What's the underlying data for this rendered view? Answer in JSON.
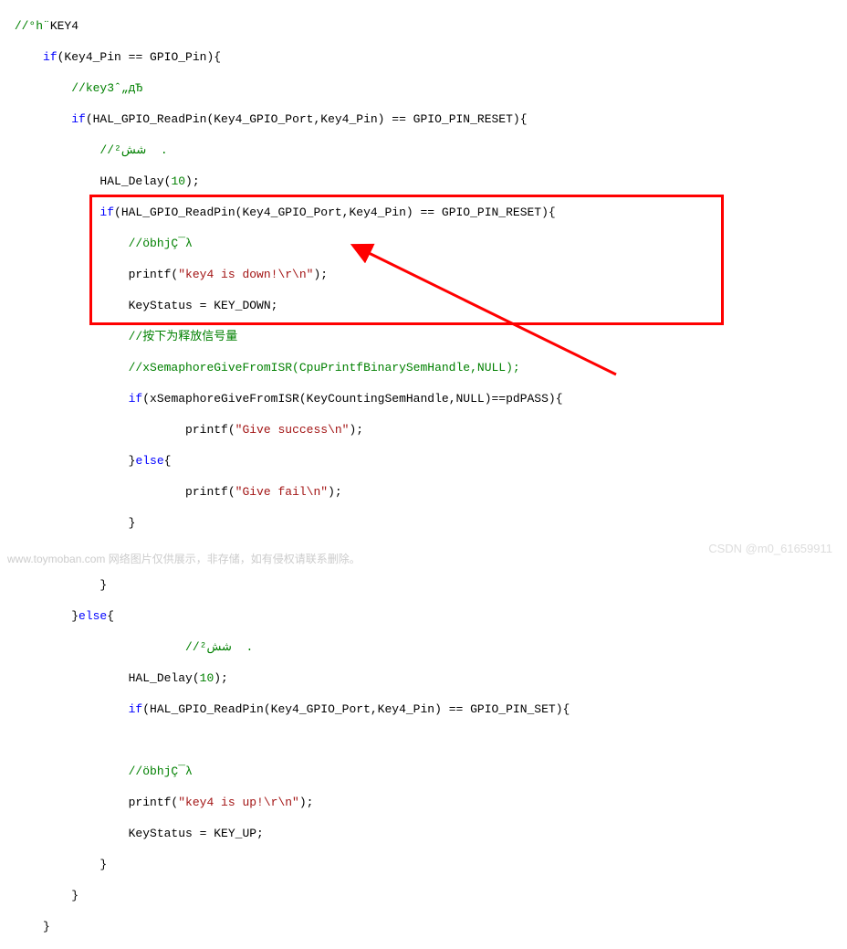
{
  "code": {
    "l1a": "//°h¨",
    "l1b": "KEY4",
    "l2": "if",
    "l2b": "(Key4_Pin == GPIO_Pin){",
    "l3": "//key3ˆ„дЂ",
    "l4a": "if",
    "l4b": "(HAL_GPIO_ReadPin(Key4_GPIO_Port,Key4_Pin) == GPIO_PIN_RESET){",
    "l5": "//شش²  .",
    "l6a": "HAL_Delay(",
    "l6b": "10",
    "l6c": ");",
    "l7a": "if",
    "l7b": "(HAL_GPIO_ReadPin(Key4_GPIO_Port,Key4_Pin) == GPIO_PIN_RESET){",
    "l8": "//öbhjÇ¯λ",
    "l9a": "printf(",
    "l9b": "\"key4 is down!\\r\\n\"",
    "l9c": ");",
    "l10": "KeyStatus = KEY_DOWN;",
    "l11": "//按下为释放信号量",
    "l12": "//xSemaphoreGiveFromISR(CpuPrintfBinarySemHandle,NULL);",
    "l13a": "if",
    "l13b": "(xSemaphoreGiveFromISR(KeyCountingSemHandle,NULL)==pdPASS){",
    "l14a": "printf(",
    "l14b": "\"Give success\\n\"",
    "l14c": ");",
    "l15a": "}",
    "l15b": "else",
    "l15c": "{",
    "l16a": "printf(",
    "l16b": "\"Give fail\\n\"",
    "l16c": ");",
    "l17": "}",
    "l18": "",
    "l19": "}",
    "l20a": "}",
    "l20b": "else",
    "l20c": "{",
    "l21": "//شش²  .",
    "l22a": "HAL_Delay(",
    "l22b": "10",
    "l22c": ");",
    "l23a": "if",
    "l23b": "(HAL_GPIO_ReadPin(Key4_GPIO_Port,Key4_Pin) == GPIO_PIN_SET){",
    "l24": "",
    "l25": "//öbhjÇ¯λ",
    "l26a": "printf(",
    "l26b": "\"key4 is up!\\r\\n\"",
    "l26c": ");",
    "l27": "KeyStatus = KEY_UP;",
    "l28": "}",
    "l29": "}",
    "l30": "}"
  },
  "watermarks": {
    "left": "www.toymoban.com 网络图片仅供展示，非存储，如有侵权请联系删除。",
    "right": "CSDN @m0_61659911"
  }
}
